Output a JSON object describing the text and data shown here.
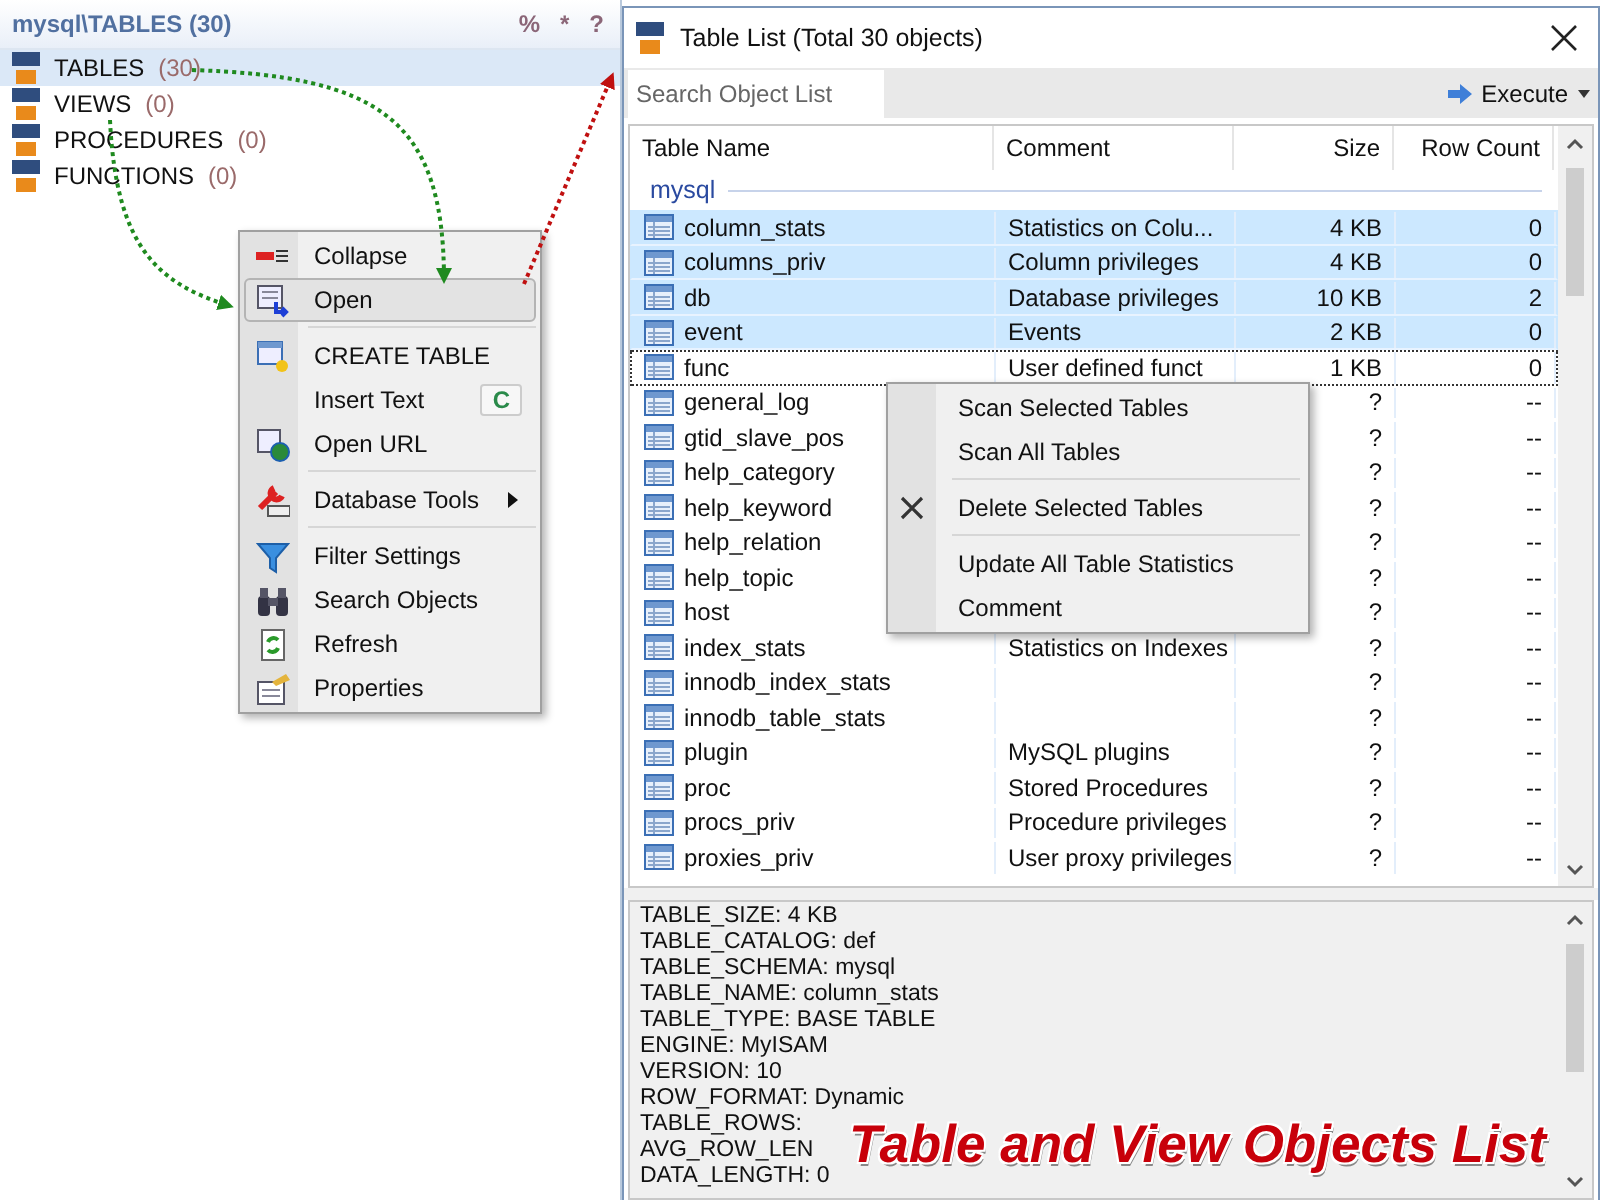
{
  "tree": {
    "title": "mysql\\TABLES (30)",
    "tools": [
      "%",
      "*",
      "?"
    ],
    "items": [
      {
        "label": "TABLES",
        "count": "(30)",
        "selected": true
      },
      {
        "label": "VIEWS",
        "count": "(0)",
        "selected": false
      },
      {
        "label": "PROCEDURES",
        "count": "(0)",
        "selected": false
      },
      {
        "label": "FUNCTIONS",
        "count": "(0)",
        "selected": false
      }
    ]
  },
  "context_menu": {
    "items": [
      {
        "kind": "item",
        "label": "Collapse",
        "selected": false
      },
      {
        "kind": "item",
        "label": "Open",
        "selected": true
      },
      {
        "kind": "separator"
      },
      {
        "kind": "item",
        "label": "CREATE TABLE",
        "selected": false
      },
      {
        "kind": "item",
        "label": "Insert Text",
        "shortcut": "C",
        "selected": false
      },
      {
        "kind": "item",
        "label": "Open URL",
        "selected": false
      },
      {
        "kind": "separator"
      },
      {
        "kind": "submenu",
        "label": "Database Tools",
        "selected": false
      },
      {
        "kind": "separator"
      },
      {
        "kind": "item",
        "label": "Filter Settings",
        "selected": false
      },
      {
        "kind": "item",
        "label": "Search Objects",
        "selected": false
      },
      {
        "kind": "item",
        "label": "Refresh",
        "selected": false
      },
      {
        "kind": "item",
        "label": "Properties",
        "selected": false
      }
    ]
  },
  "table_list": {
    "title": "Table List (Total 30 objects)",
    "search": {
      "placeholder": "Search Object List"
    },
    "execute": "Execute",
    "columns": [
      "Table Name",
      "Comment",
      "Size",
      "Row Count"
    ],
    "group": "mysql",
    "rows": [
      {
        "name": "column_stats",
        "comment": "Statistics on Colu...",
        "size": "4 KB",
        "row_count": "0",
        "selected": true,
        "focused": false
      },
      {
        "name": "columns_priv",
        "comment": "Column privileges",
        "size": "4 KB",
        "row_count": "0",
        "selected": true,
        "focused": false
      },
      {
        "name": "db",
        "comment": "Database privileges",
        "size": "10 KB",
        "row_count": "2",
        "selected": true,
        "focused": false
      },
      {
        "name": "event",
        "comment": "Events",
        "size": "2 KB",
        "row_count": "0",
        "selected": true,
        "focused": false
      },
      {
        "name": "func",
        "comment": "User defined funct",
        "size": "1 KB",
        "row_count": "0",
        "selected": false,
        "focused": true
      },
      {
        "name": "general_log",
        "size": "?",
        "row_count": "--",
        "selected": false,
        "focused": false
      },
      {
        "name": "gtid_slave_pos",
        "size": "?",
        "row_count": "--",
        "selected": false,
        "focused": false
      },
      {
        "name": "help_category",
        "size": "?",
        "row_count": "--",
        "selected": false,
        "focused": false
      },
      {
        "name": "help_keyword",
        "size": "?",
        "row_count": "--",
        "selected": false,
        "focused": false
      },
      {
        "name": "help_relation",
        "size": "?",
        "row_count": "--",
        "selected": false,
        "focused": false
      },
      {
        "name": "help_topic",
        "size": "?",
        "row_count": "--",
        "selected": false,
        "focused": false
      },
      {
        "name": "host",
        "size": "?",
        "row_count": "--",
        "selected": false,
        "focused": false
      },
      {
        "name": "index_stats",
        "comment": "Statistics on Indexes",
        "size": "?",
        "row_count": "--",
        "selected": false,
        "focused": false
      },
      {
        "name": "innodb_index_stats",
        "size": "?",
        "row_count": "--",
        "selected": false,
        "focused": false
      },
      {
        "name": "innodb_table_stats",
        "size": "?",
        "row_count": "--",
        "selected": false,
        "focused": false
      },
      {
        "name": "plugin",
        "comment": "MySQL plugins",
        "size": "?",
        "row_count": "--",
        "selected": false,
        "focused": false
      },
      {
        "name": "proc",
        "comment": "Stored Procedures",
        "size": "?",
        "row_count": "--",
        "selected": false,
        "focused": false
      },
      {
        "name": "procs_priv",
        "comment": "Procedure privileges",
        "size": "?",
        "row_count": "--",
        "selected": false,
        "focused": false
      },
      {
        "name": "proxies_priv",
        "comment": "User proxy privileges",
        "size": "?",
        "row_count": "--",
        "selected": false,
        "focused": false
      }
    ],
    "context_menu": [
      {
        "kind": "item",
        "label": "Scan Selected Tables"
      },
      {
        "kind": "item",
        "label": "Scan All Tables"
      },
      {
        "kind": "separator"
      },
      {
        "kind": "delete",
        "label": "Delete Selected Tables"
      },
      {
        "kind": "separator"
      },
      {
        "kind": "item",
        "label": "Update All Table Statistics"
      },
      {
        "kind": "item",
        "label": "Comment"
      }
    ]
  },
  "details": [
    "TABLE_SIZE: 4 KB",
    "TABLE_CATALOG: def",
    "TABLE_SCHEMA: mysql",
    "TABLE_NAME: column_stats",
    "TABLE_TYPE: BASE TABLE",
    "ENGINE: MyISAM",
    "VERSION: 10",
    "ROW_FORMAT: Dynamic",
    "TABLE_ROWS:",
    "AVG_ROW_LEN",
    "DATA_LENGTH: 0"
  ],
  "caption": "Table and View Objects List"
}
